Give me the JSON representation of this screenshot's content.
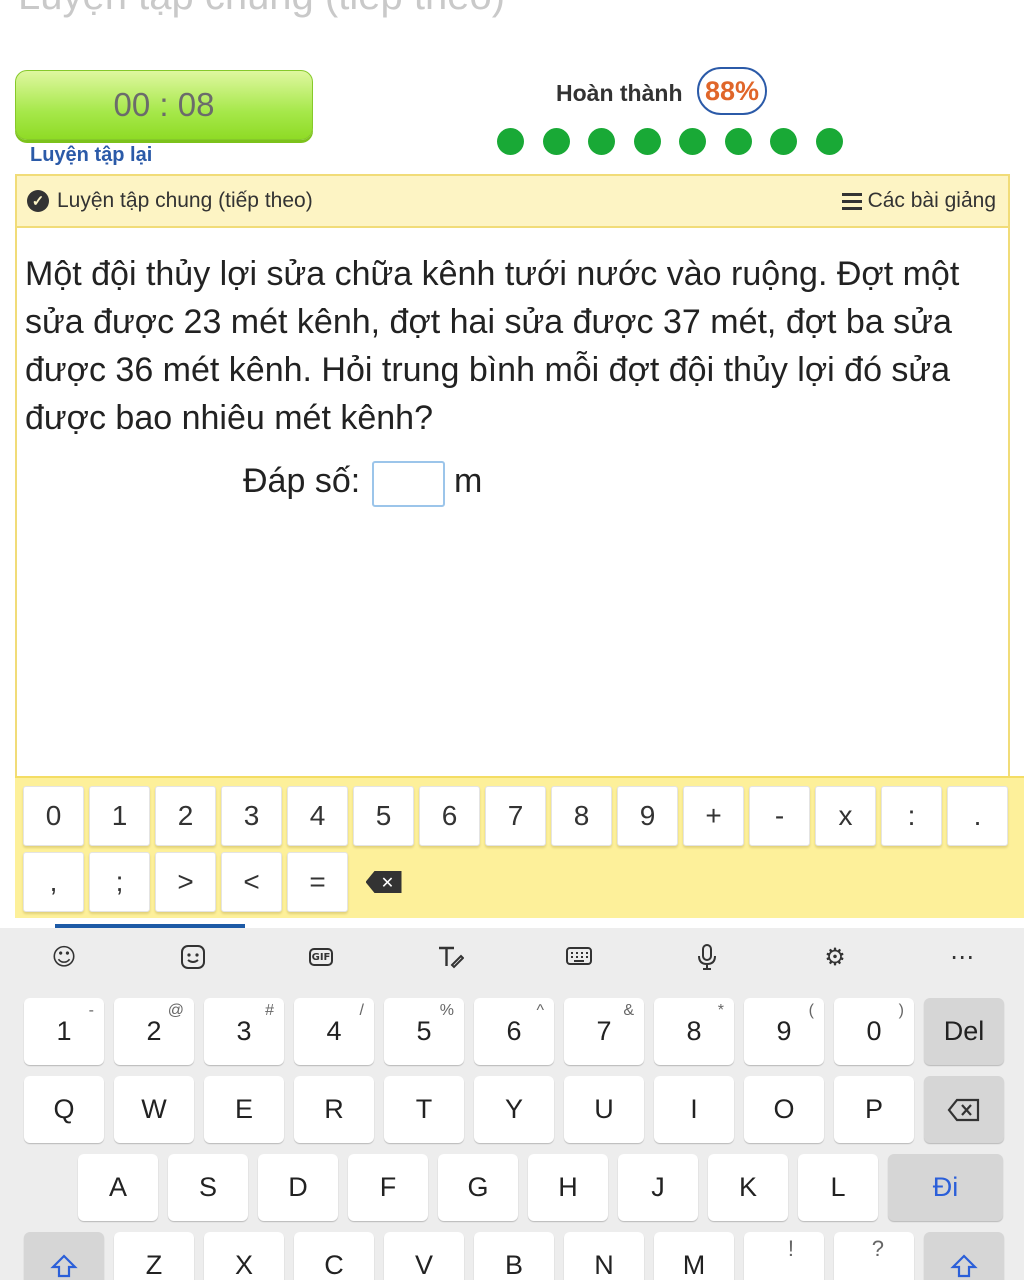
{
  "header": {
    "cut_title": "Luyện tập chung (tiếp theo)",
    "timer": "00 : 08",
    "retry_label": "Luyện tập lại",
    "progress_label": "Hoàn thành",
    "progress_value": "88%",
    "progress_dots_count": 8
  },
  "lesson_bar": {
    "title": "Luyện tập chung (tiếp theo)",
    "lessons_label": "Các bài giảng"
  },
  "question": {
    "text": "Một đội thủy lợi sửa chữa kênh tưới nước vào ruộng. Đợt một sửa được 23 mét kênh, đợt hai sửa được 37 mét, đợt ba sửa được 36 mét kênh. Hỏi trung bình mỗi đợt đội thủy lợi đó sửa được bao nhiêu mét kênh?",
    "answer_label": "Đáp số:",
    "answer_value": "",
    "answer_unit": "m"
  },
  "keypad": {
    "row1": [
      "0",
      "1",
      "2",
      "3",
      "4",
      "5",
      "6",
      "7",
      "8",
      "9",
      "+",
      "-",
      "x",
      ":",
      "."
    ],
    "row2": [
      ",",
      ";",
      ">",
      "<",
      "="
    ]
  },
  "keyboard": {
    "numbers": [
      {
        "k": "1",
        "s": "-"
      },
      {
        "k": "2",
        "s": "@"
      },
      {
        "k": "3",
        "s": "#"
      },
      {
        "k": "4",
        "s": "/"
      },
      {
        "k": "5",
        "s": "%"
      },
      {
        "k": "6",
        "s": "^"
      },
      {
        "k": "7",
        "s": "&"
      },
      {
        "k": "8",
        "s": "*"
      },
      {
        "k": "9",
        "s": "("
      },
      {
        "k": "0",
        "s": ")"
      }
    ],
    "del_label": "Del",
    "row_q": [
      "Q",
      "W",
      "E",
      "R",
      "T",
      "Y",
      "U",
      "I",
      "O",
      "P"
    ],
    "row_a": [
      "A",
      "S",
      "D",
      "F",
      "G",
      "H",
      "J",
      "K",
      "L"
    ],
    "enter_label": "Đi",
    "row_z": [
      "Z",
      "X",
      "C",
      "V",
      "B",
      "N",
      "M"
    ],
    "row_z_extra": [
      {
        "k": "",
        "s": "!"
      },
      {
        "k": "",
        "s": "?"
      }
    ]
  }
}
